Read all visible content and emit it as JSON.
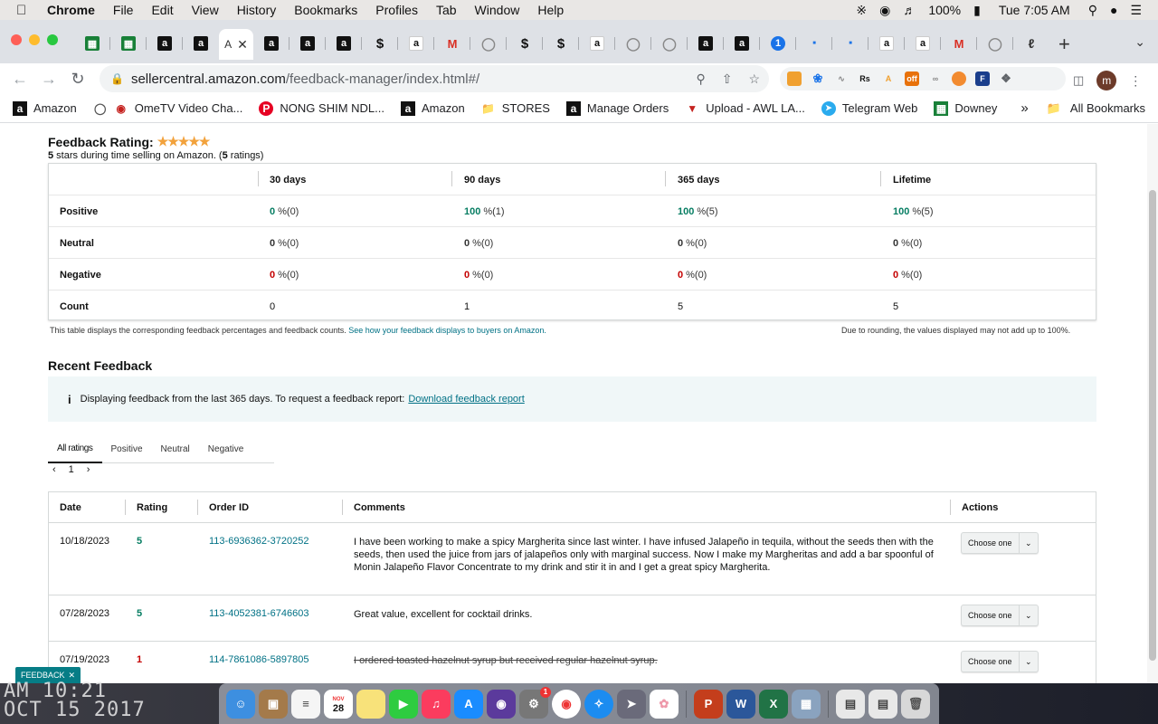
{
  "menubar": {
    "app": "Chrome",
    "items": [
      "File",
      "Edit",
      "View",
      "History",
      "Bookmarks",
      "Profiles",
      "Tab",
      "Window",
      "Help"
    ],
    "battery": "100%",
    "clock": "Tue 7:05 AM"
  },
  "tabs": {
    "active_title": "A",
    "new_tab": "+"
  },
  "toolbar": {
    "url_host": "sellercentral.amazon.com",
    "url_path": "/feedback-manager/index.html#/",
    "avatar_initial": "m"
  },
  "bookmarks": [
    {
      "label": "Amazon",
      "icon": "amazon-icon"
    },
    {
      "label": "OmeTV Video Cha...",
      "icon": "globe-icon"
    },
    {
      "label": "NONG SHIM NDL...",
      "icon": "pinterest-icon"
    },
    {
      "label": "Amazon",
      "icon": "amazon-icon"
    },
    {
      "label": "STORES",
      "icon": "folder-icon"
    },
    {
      "label": "Manage Orders",
      "icon": "amazon-icon"
    },
    {
      "label": "Upload - AWL LA...",
      "icon": "awl-icon"
    },
    {
      "label": "Telegram Web",
      "icon": "telegram-icon"
    },
    {
      "label": "Downey",
      "icon": "sheets-icon"
    }
  ],
  "bookmarks_more": "»",
  "all_bookmarks": "All Bookmarks",
  "feedback_rating": {
    "title": "Feedback Rating:",
    "stars": "★★★★★",
    "summary_stars": "5",
    "summary_text": " stars during time selling on Amazon. (",
    "summary_count": "5",
    "summary_end": " ratings)",
    "columns": [
      "30 days",
      "90 days",
      "365 days",
      "Lifetime"
    ],
    "rows": [
      {
        "label": "Positive",
        "kind": "g",
        "cells": [
          [
            "0",
            "%(0)"
          ],
          [
            "100",
            "%(1)"
          ],
          [
            "100",
            "%(5)"
          ],
          [
            "100",
            "%(5)"
          ]
        ]
      },
      {
        "label": "Neutral",
        "kind": "n",
        "cells": [
          [
            "0",
            "%(0)"
          ],
          [
            "0",
            "%(0)"
          ],
          [
            "0",
            "%(0)"
          ],
          [
            "0",
            "%(0)"
          ]
        ]
      },
      {
        "label": "Negative",
        "kind": "r",
        "cells": [
          [
            "0",
            "%(0)"
          ],
          [
            "0",
            "%(0)"
          ],
          [
            "0",
            "%(0)"
          ],
          [
            "0",
            "%(0)"
          ]
        ]
      },
      {
        "label": "Count",
        "kind": "c",
        "cells": [
          [
            "0",
            ""
          ],
          [
            "1",
            ""
          ],
          [
            "5",
            ""
          ],
          [
            "5",
            ""
          ]
        ]
      }
    ],
    "note": "This table displays the corresponding feedback percentages and feedback counts.",
    "note_link": "See how your feedback displays to buyers on Amazon.",
    "note_right": "Due to rounding, the values displayed may not add up to 100%."
  },
  "recent": {
    "title": "Recent Feedback",
    "info": "Displaying feedback from the last 365 days. To request a feedback report:",
    "info_link": "Download feedback report",
    "tabs": [
      "All ratings",
      "Positive",
      "Neutral",
      "Negative"
    ],
    "page": "1",
    "headers": [
      "Date",
      "Rating",
      "Order ID",
      "Comments",
      "Actions"
    ],
    "action_label": "Choose one",
    "rows": [
      {
        "date": "10/18/2023",
        "rating": "5",
        "order": "113-6936362-3720252",
        "comment": "I have been working to make a spicy Margherita since last winter. I have infused Jalapeño in tequila, without the seeds then with the seeds, then used the juice from jars of jalapeños only with marginal success. Now I make my Margheritas and add a bar spoonful of Monin Jalapeño Flavor Concentrate to my drink and stir it in and I get a great spicy Margherita."
      },
      {
        "date": "07/28/2023",
        "rating": "5",
        "order": "113-4052381-6746603",
        "comment": "Great value, excellent for cocktail drinks."
      },
      {
        "date": "07/19/2023",
        "rating": "1",
        "order": "114-7861086-5897805",
        "comment": "I ordered toasted hazelnut syrup but received regular hazelnut syrup."
      }
    ]
  },
  "feedback_button": "FEEDBACK",
  "desktop_clock": {
    "line1": "AM 10:21",
    "line2": "OCT 15 2017"
  },
  "dock": {
    "calendar_month": "NOV",
    "calendar_day": "28",
    "badge": "1"
  }
}
